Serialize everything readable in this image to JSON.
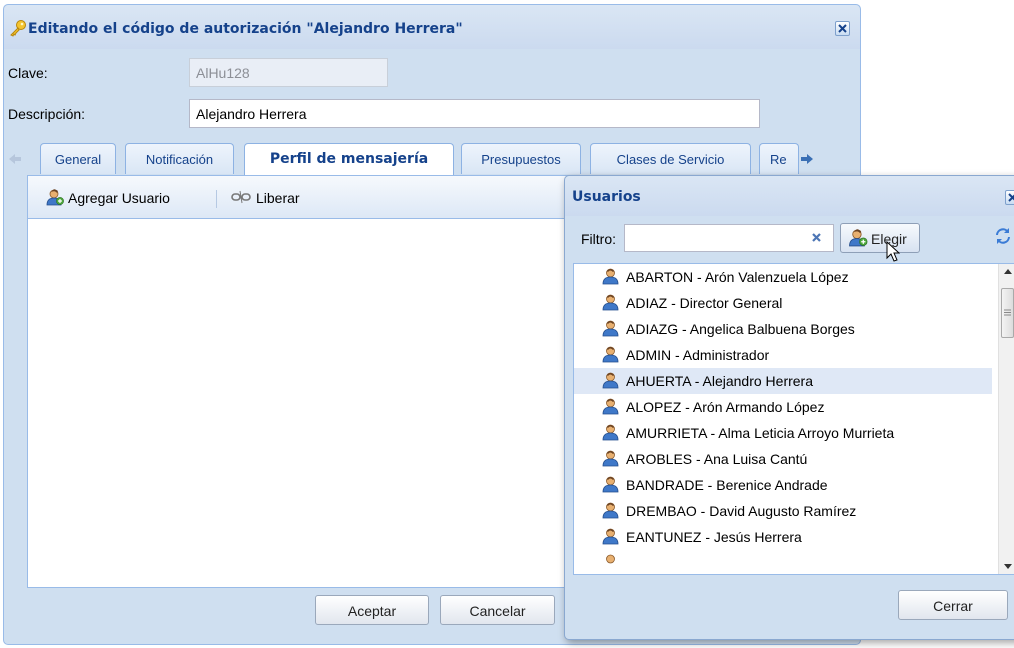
{
  "dialog": {
    "title": "Editando el código de autorización \"Alejandro Herrera\"",
    "clave_label": "Clave:",
    "clave_value": "AlHu128",
    "descripcion_label": "Descripción:",
    "descripcion_value": "Alejandro Herrera",
    "tabs": [
      {
        "label": "General"
      },
      {
        "label": "Notificación"
      },
      {
        "label": "Perfil de mensajería"
      },
      {
        "label": "Presupuestos"
      },
      {
        "label": "Clases de Servicio"
      },
      {
        "label": "Re"
      }
    ],
    "active_tab": "Perfil de mensajería",
    "toolbar": {
      "add_user": "Agregar Usuario",
      "release": "Liberar"
    },
    "accept": "Aceptar",
    "cancel": "Cancelar"
  },
  "users_popup": {
    "title": "Usuarios",
    "filter_label": "Filtro:",
    "filter_value": "",
    "pick_button": "Elegir",
    "close_button": "Cerrar",
    "selected_user": "AHUERTA - Alejandro Herrera",
    "users": [
      "ABARTON - Arón Valenzuela López",
      "ADIAZ - Director General",
      "ADIAZG - Angelica Balbuena Borges",
      "ADMIN - Administrador",
      "AHUERTA - Alejandro Herrera",
      "ALOPEZ - Arón Armando López",
      "AMURRIETA - Alma Leticia Arroyo Murrieta",
      "AROBLES - Ana Luisa Cantú",
      "BANDRADE - Berenice Andrade",
      "DREMBAO - David Augusto Ramírez",
      "EANTUNEZ - Jesús Herrera"
    ]
  },
  "icons": {
    "title_icon": "key-icon",
    "user_icon": "user-icon",
    "add_user_icon": "add-user-icon",
    "release_icon": "unlink-icon",
    "refresh_icon": "refresh-icon",
    "close_icon": "close-icon"
  },
  "colors": {
    "header_text": "#15428b",
    "frame": "#cfdff0",
    "selection": "#dfe8f6"
  }
}
